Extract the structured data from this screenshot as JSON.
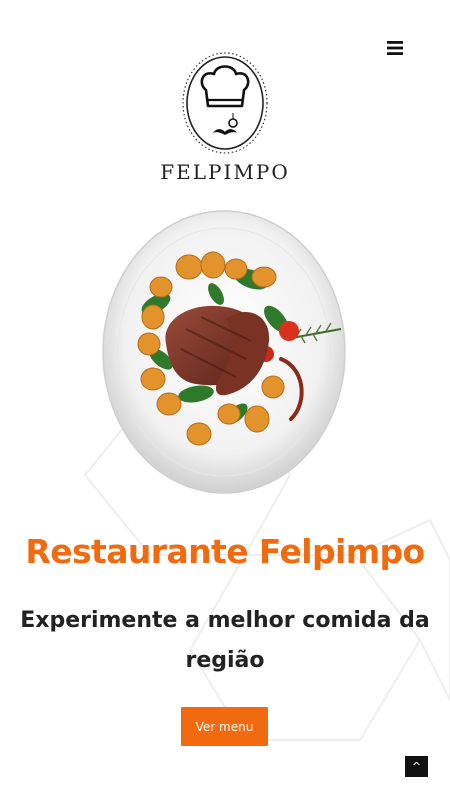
{
  "header": {
    "menu_icon": "hamburger-icon",
    "logo": {
      "name": "FELPIMPO",
      "icon": "chef-hat-mustache-icon"
    }
  },
  "hero": {
    "image": "steak-with-roasted-potatoes-plate",
    "title": "Restaurante Felpimpo",
    "subtitle": "Experimente a melhor comida da região",
    "cta_label": "Ver menu"
  },
  "scroll_top": {
    "label": "^"
  },
  "colors": {
    "accent": "#f26a0f",
    "text_dark": "#222222",
    "background": "#ffffff"
  }
}
